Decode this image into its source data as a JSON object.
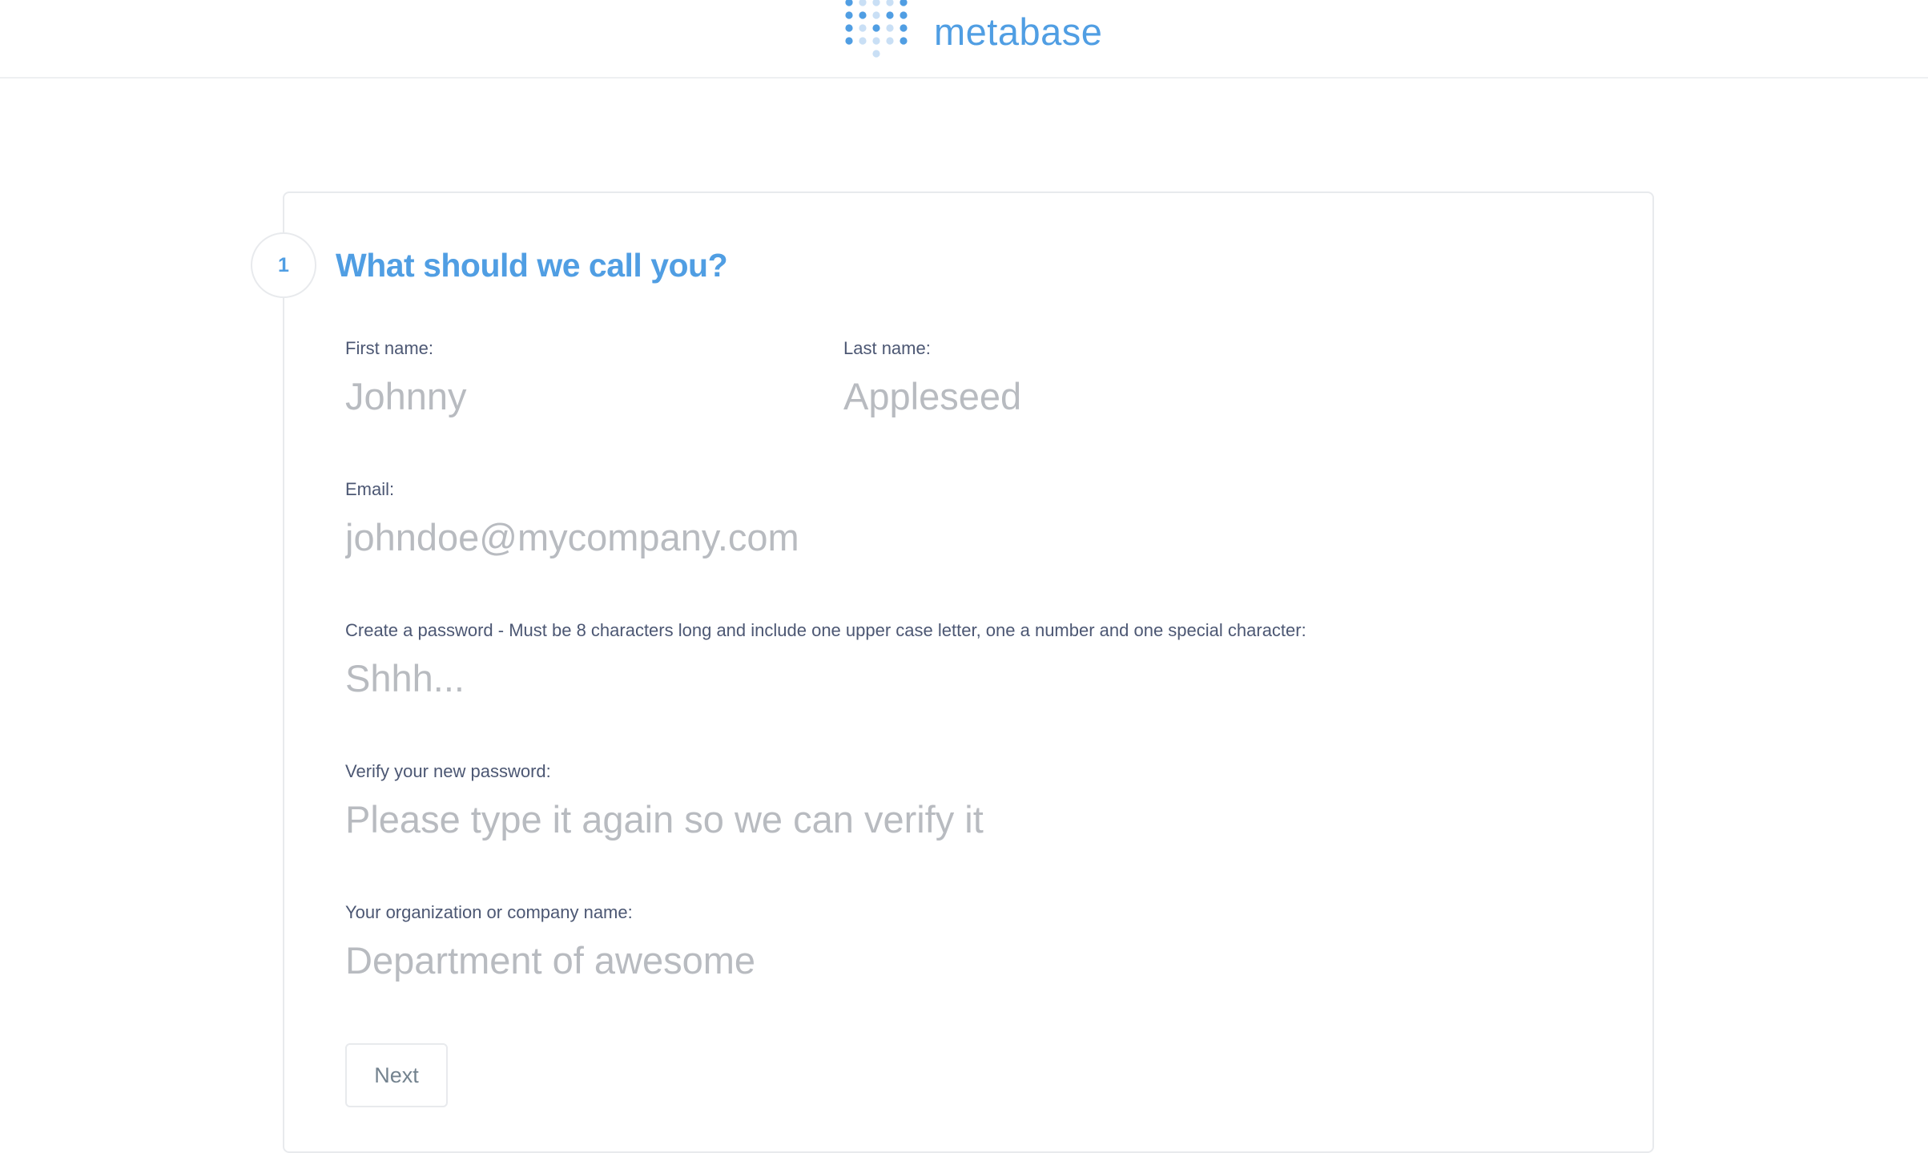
{
  "header": {
    "brand_name": "metabase",
    "logo_icon": "metabase-dots-logo",
    "brand_color": "#509ee3"
  },
  "step": {
    "number": "1",
    "title": "What should we call you?"
  },
  "form": {
    "first_name": {
      "label": "First name:",
      "placeholder": "Johnny",
      "value": ""
    },
    "last_name": {
      "label": "Last name:",
      "placeholder": "Appleseed",
      "value": ""
    },
    "email": {
      "label": "Email:",
      "placeholder": "johndoe@mycompany.com",
      "value": ""
    },
    "password": {
      "label": "Create a password - Must be 8 characters long and include one upper case letter, one a number and one special character:",
      "placeholder": "Shhh...",
      "value": ""
    },
    "verify_password": {
      "label": "Verify your new password:",
      "placeholder": "Please type it again so we can verify it",
      "value": ""
    },
    "organization": {
      "label": "Your organization or company name:",
      "placeholder": "Department of awesome",
      "value": ""
    },
    "next_label": "Next"
  },
  "colors": {
    "accent": "#509ee3",
    "label": "#4c5773",
    "placeholder": "#b8bbc0",
    "border": "#e8eaed"
  }
}
